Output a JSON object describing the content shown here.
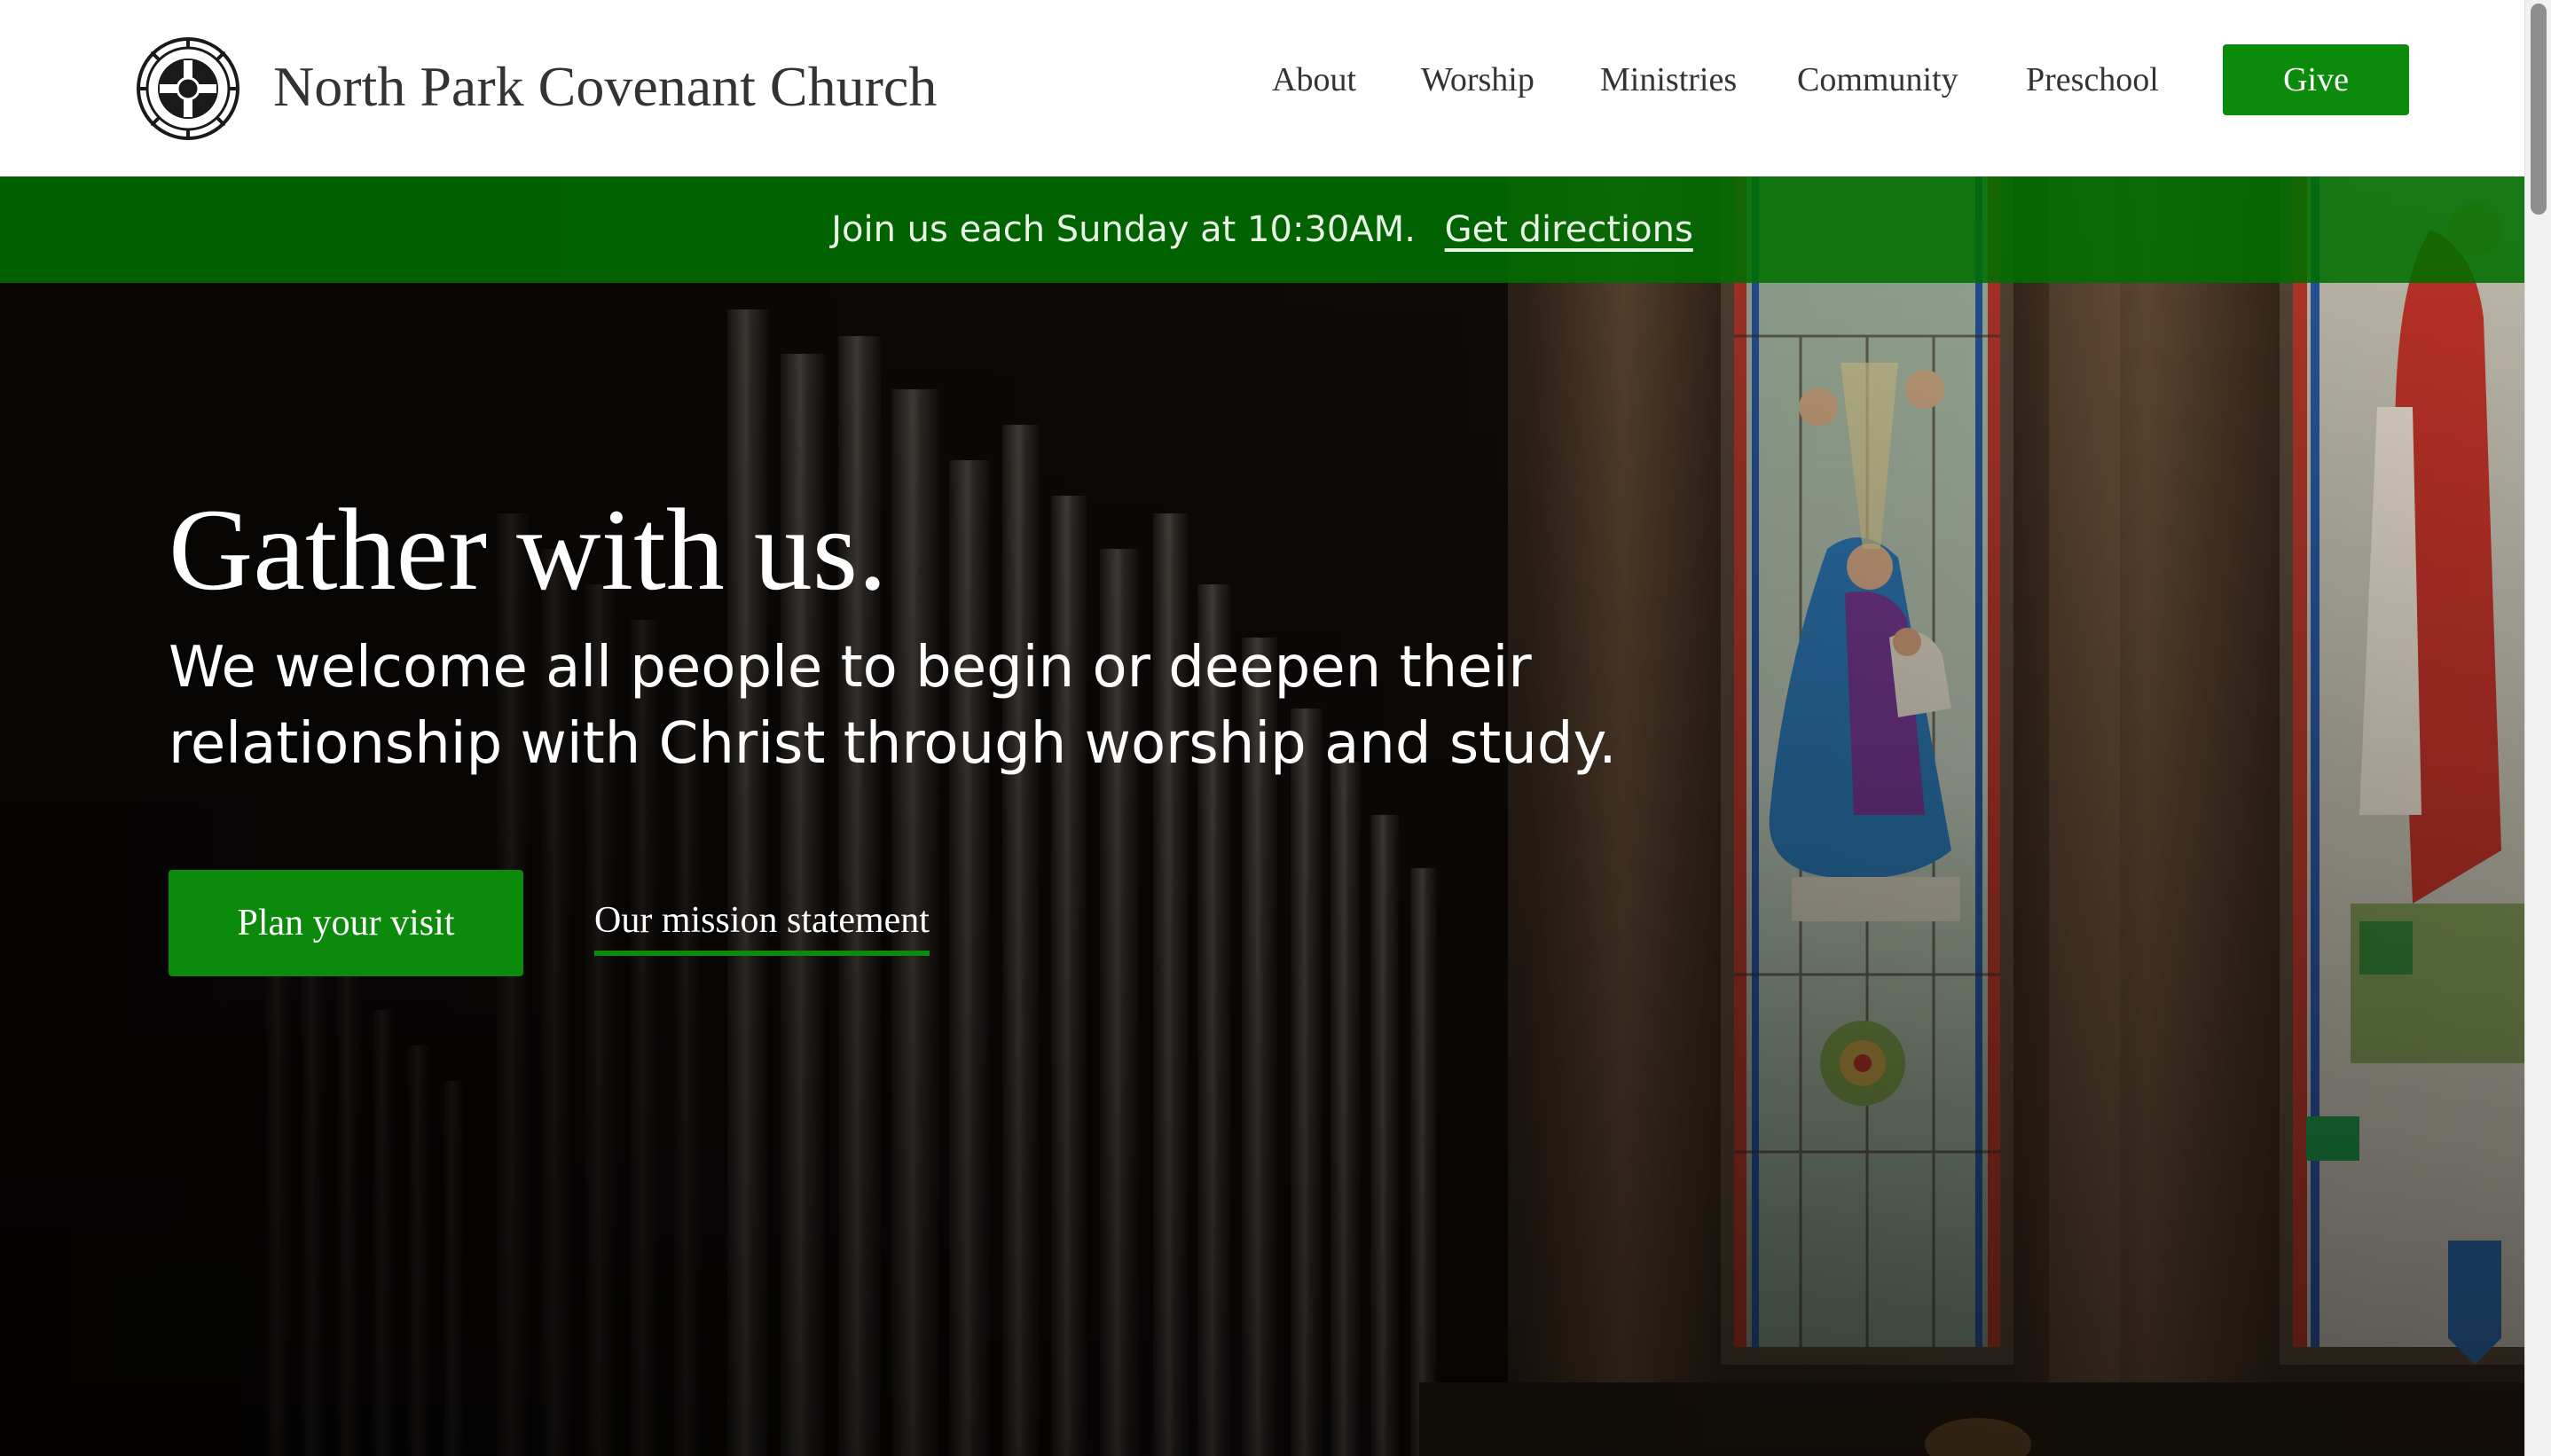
{
  "header": {
    "site_title": "North Park Covenant Church",
    "nav": [
      "About",
      "Worship",
      "Ministries",
      "Community",
      "Preschool"
    ],
    "give_label": "Give"
  },
  "announcement": {
    "text": "Join us each Sunday at 10:30AM.",
    "link_label": "Get directions"
  },
  "hero": {
    "title": "Gather with us.",
    "subtitle": "We welcome all people to begin or deepen their relationship with Christ through worship and study.",
    "primary_button": "Plan your visit",
    "secondary_link": "Our mission statement"
  },
  "colors": {
    "brand_green": "#0b8a0b",
    "announcement_green": "#006e00",
    "header_text": "#333333"
  },
  "icons": {
    "logo": "church-logo-icon"
  }
}
